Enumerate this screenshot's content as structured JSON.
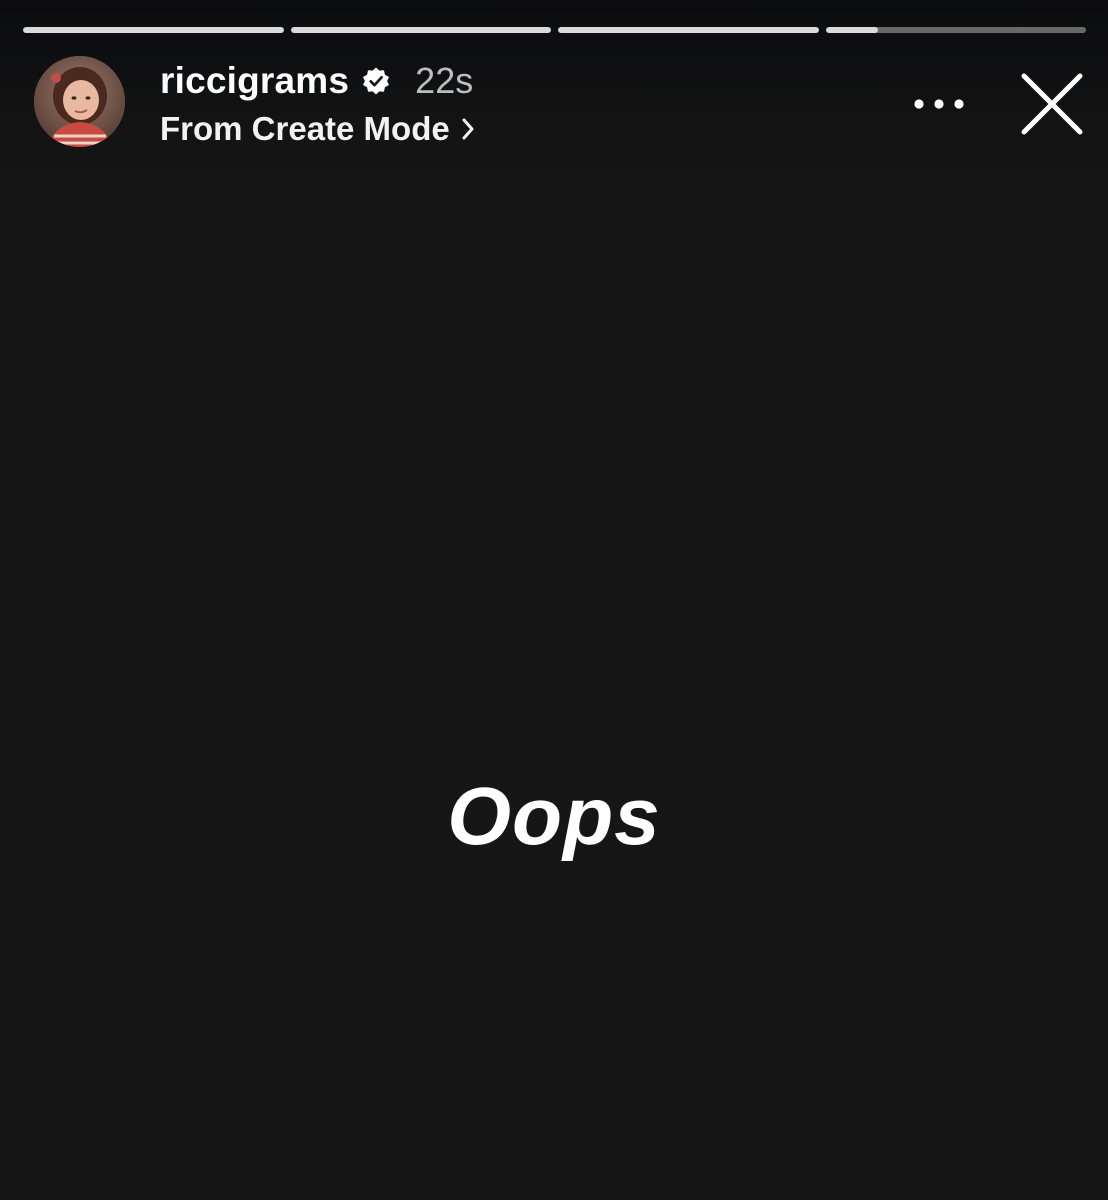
{
  "story": {
    "progress": [
      {
        "fill": 1.0
      },
      {
        "fill": 1.0
      },
      {
        "fill": 1.0
      },
      {
        "fill": 0.2
      }
    ],
    "header": {
      "avatar_icon": "profile-photo",
      "username": "riccigrams",
      "verified_icon": "verified-badge-icon",
      "time": "22s",
      "source": "From Create Mode",
      "source_icon": "chevron-right-icon",
      "more_icon": "more-options-icon",
      "close_icon": "close-icon"
    },
    "caption": "Oops"
  },
  "colors": {
    "background": "#161616",
    "progress_fill": "#dadada",
    "text": "#ffffff",
    "time_text": "#bdbdbd"
  }
}
